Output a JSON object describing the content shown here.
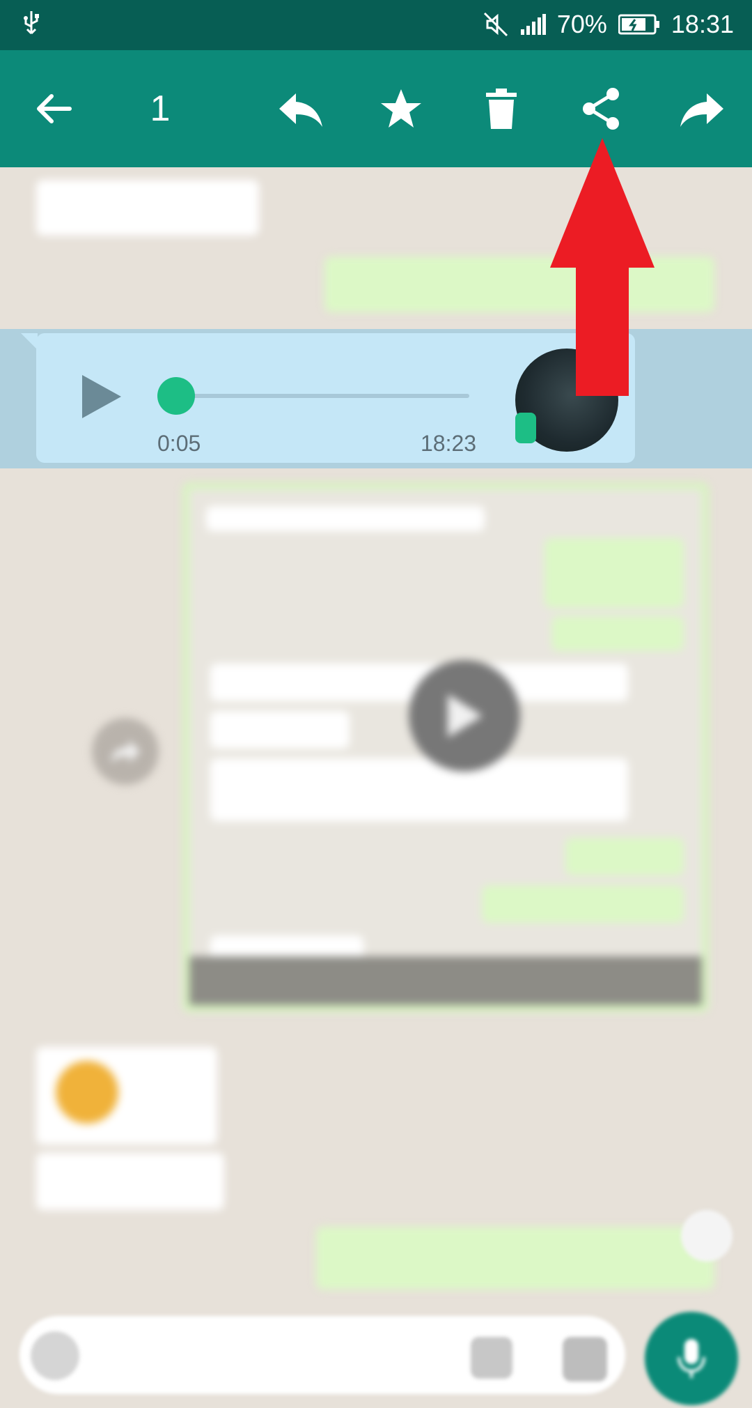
{
  "status_bar": {
    "battery_percent": "70%",
    "time": "18:31"
  },
  "toolbar": {
    "selected_count": "1",
    "icons": [
      "back-arrow-icon",
      "reply-icon",
      "star-icon",
      "delete-icon",
      "share-icon",
      "forward-icon"
    ]
  },
  "voice_message": {
    "duration": "0:05",
    "time": "18:23",
    "progress": 0
  },
  "colors": {
    "status_bar": "#075e54",
    "toolbar": "#0c8a79",
    "knob": "#1dbe85",
    "arrow": "#ec1c24",
    "incoming": "#ffffff",
    "outgoing": "#dcf8c6"
  }
}
